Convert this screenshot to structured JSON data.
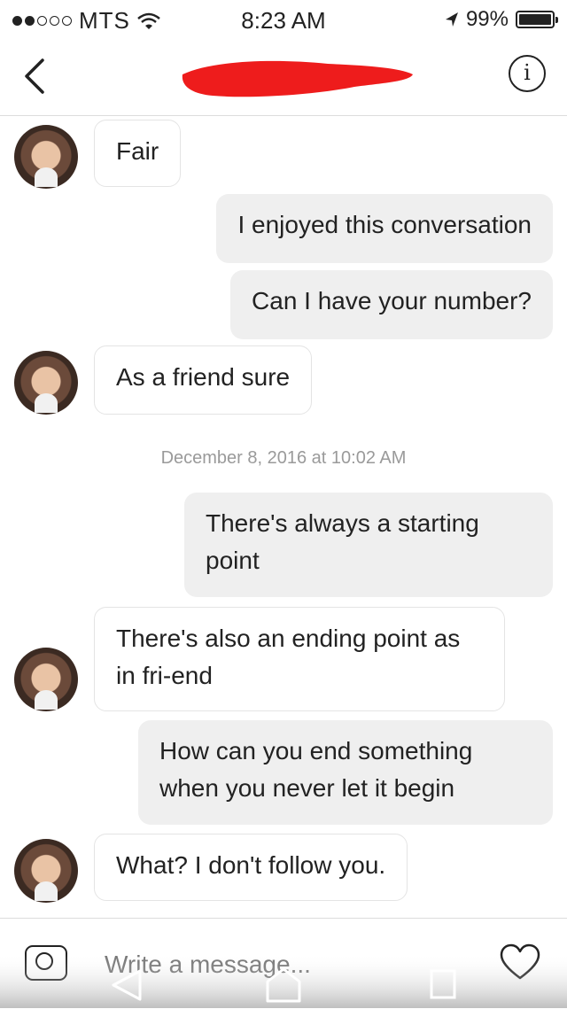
{
  "status_bar": {
    "carrier": "MTS",
    "time": "8:23 AM",
    "battery": "99%",
    "battery_level": 0.99,
    "signal_strength": 2,
    "signal_max": 5
  },
  "header": {
    "title": ""
  },
  "messages": [
    {
      "side": "in",
      "text": "Fair"
    },
    {
      "side": "out",
      "text": "I enjoyed this conversation"
    },
    {
      "side": "out",
      "text": "Can I have your number?"
    },
    {
      "side": "in",
      "text": "As a friend sure"
    },
    {
      "side": "timestamp",
      "text": "December 8, 2016 at 10:02 AM"
    },
    {
      "side": "out",
      "text": "There's always a starting point"
    },
    {
      "side": "in",
      "text": "There's also an ending point as in fri-end"
    },
    {
      "side": "out",
      "text": "How can you end something when you never let it begin"
    },
    {
      "side": "in",
      "text": "What? I don't follow you."
    }
  ],
  "composer": {
    "placeholder": "Write a message..."
  },
  "icons": {
    "back": "chevron-left-icon",
    "info": "info-icon",
    "camera": "camera-icon",
    "like": "heart-icon",
    "nav_back": "triangle-back-icon",
    "nav_home": "home-icon",
    "nav_recent": "square-icon"
  },
  "colors": {
    "redaction": "#ee1c1c",
    "outgoing_bubble": "#efefef",
    "incoming_border": "#e4e4e4"
  }
}
